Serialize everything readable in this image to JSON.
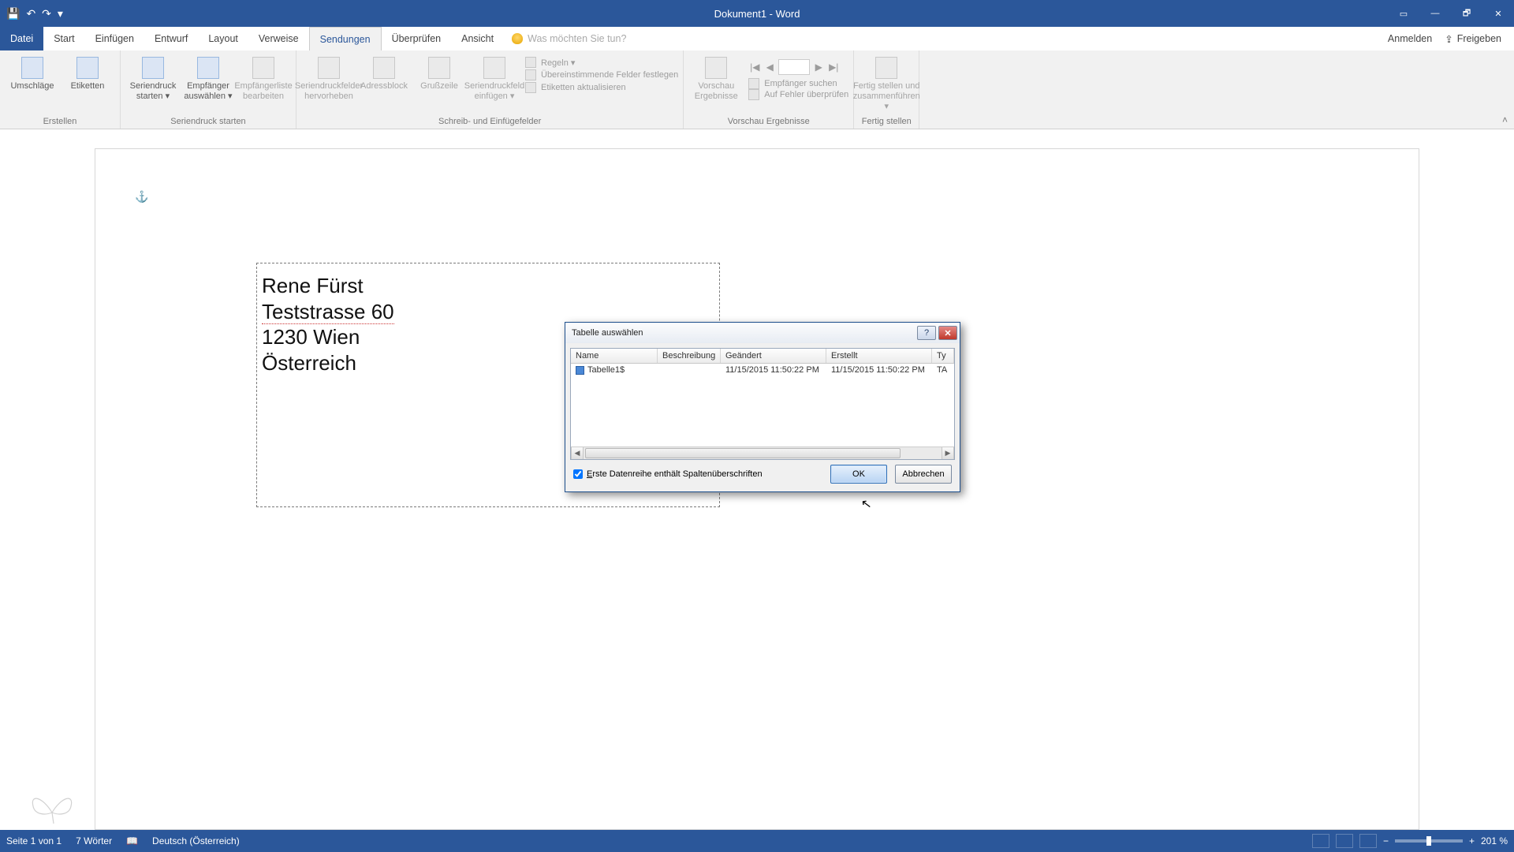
{
  "titlebar": {
    "title": "Dokument1 - Word"
  },
  "qat": {
    "save": "💾",
    "undo": "↶",
    "redo": "↷",
    "more": "▾"
  },
  "window_controls": {
    "ribbon_opts": "▭",
    "minimize": "—",
    "restore": "🗗",
    "close": "✕"
  },
  "menu": {
    "file": "Datei",
    "tabs": [
      "Start",
      "Einfügen",
      "Entwurf",
      "Layout",
      "Verweise",
      "Sendungen",
      "Überprüfen",
      "Ansicht"
    ],
    "active": "Sendungen",
    "tellme_placeholder": "Was möchten Sie tun?",
    "signin": "Anmelden",
    "share": "Freigeben"
  },
  "ribbon": {
    "create": {
      "envelopes": "Umschläge",
      "labels": "Etiketten",
      "caption": "Erstellen"
    },
    "start": {
      "start_merge": "Seriendruck starten ▾",
      "select_recipients": "Empfänger auswählen ▾",
      "edit_recipients": "Empfängerliste bearbeiten",
      "caption": "Seriendruck starten"
    },
    "fields": {
      "highlight": "Seriendruckfelder hervorheben",
      "addressblock": "Adressblock",
      "greeting": "Grußzeile",
      "insert_field": "Seriendruckfeld einfügen ▾",
      "rules": "Regeln ▾",
      "match": "Übereinstimmende Felder festlegen",
      "update": "Etiketten aktualisieren",
      "caption": "Schreib- und Einfügefelder"
    },
    "preview": {
      "preview_results": "Vorschau Ergebnisse",
      "find": "Empfänger suchen",
      "errors": "Auf Fehler überprüfen",
      "caption": "Vorschau Ergebnisse",
      "nav_first": "|◀",
      "nav_prev": "◀",
      "nav_next": "▶",
      "nav_last": "▶|"
    },
    "finish": {
      "finish_merge": "Fertig stellen und zusammenführen ▾",
      "caption": "Fertig stellen"
    }
  },
  "document": {
    "address": [
      "Rene Fürst",
      "Teststrasse 60",
      "1230 Wien",
      "Österreich"
    ]
  },
  "dialog": {
    "title": "Tabelle auswählen",
    "columns": {
      "name": "Name",
      "desc": "Beschreibung",
      "mod": "Geändert",
      "cre": "Erstellt",
      "typ": "Ty"
    },
    "row": {
      "name": "Tabelle1$",
      "desc": "",
      "mod": "11/15/2015 11:50:22 PM",
      "cre": "11/15/2015 11:50:22 PM",
      "typ": "TA"
    },
    "checkbox_label": "Erste Datenreihe enthält Spaltenüberschriften",
    "ok": "OK",
    "cancel": "Abbrechen"
  },
  "statusbar": {
    "page": "Seite 1 von 1",
    "words": "7 Wörter",
    "lang": "Deutsch (Österreich)",
    "zoom_minus": "−",
    "zoom_plus": "+",
    "zoom": "201 %"
  }
}
